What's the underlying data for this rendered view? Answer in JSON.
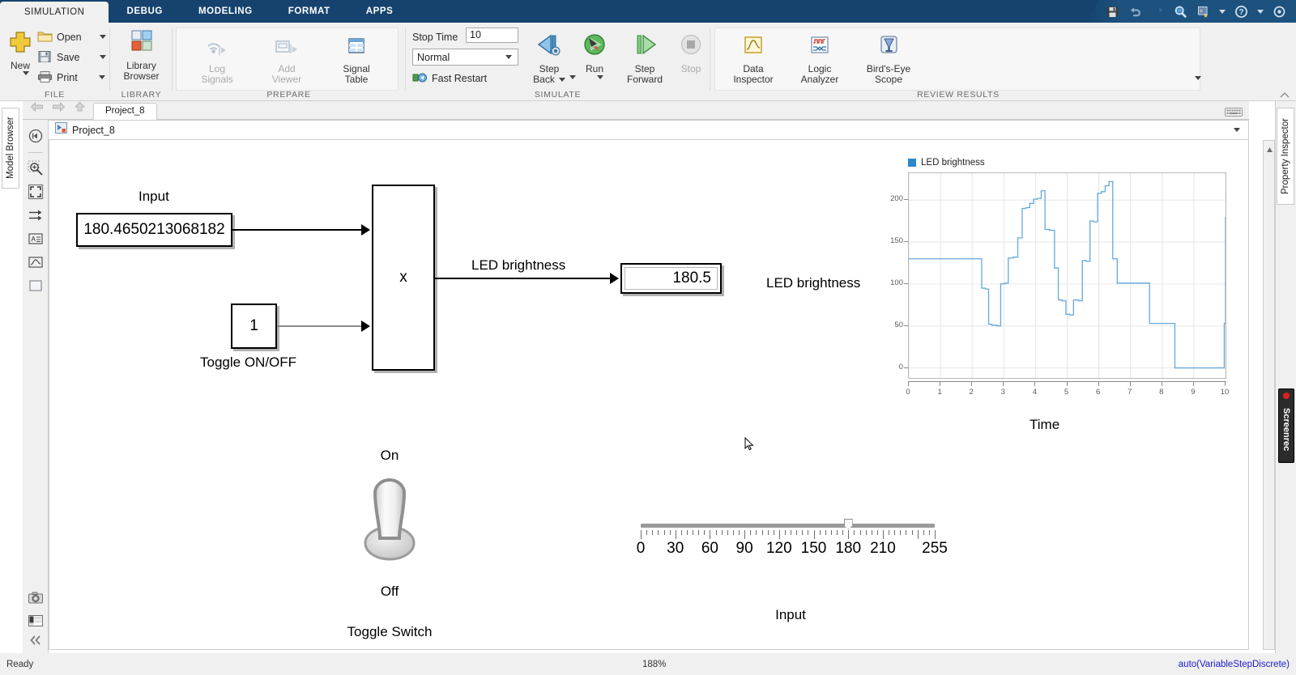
{
  "window": {
    "ribbon_tabs": [
      {
        "label": "SIMULATION",
        "active": true
      },
      {
        "label": "DEBUG",
        "active": false
      },
      {
        "label": "MODELING",
        "active": false
      },
      {
        "label": "FORMAT",
        "active": false
      },
      {
        "label": "APPS",
        "active": false
      }
    ],
    "quick_access": [
      "save-icon",
      "undo-icon",
      "redo-icon",
      "search-icon",
      "favorites-icon",
      "help-icon",
      "settings-icon"
    ]
  },
  "ribbon": {
    "file_group": {
      "label": "FILE",
      "new_label": "New",
      "items": [
        {
          "label": "Open",
          "icon": "folder-icon"
        },
        {
          "label": "Save",
          "icon": "floppy-icon"
        },
        {
          "label": "Print",
          "icon": "printer-icon"
        }
      ]
    },
    "library_group": {
      "label": "LIBRARY",
      "button": "Library\nBrowser",
      "button_line1": "Library",
      "button_line2": "Browser"
    },
    "prepare_group": {
      "label": "PREPARE",
      "items": [
        {
          "line1": "Log",
          "line2": "Signals",
          "disabled": true,
          "icon": "log-signals-icon"
        },
        {
          "line1": "Add",
          "line2": "Viewer",
          "disabled": true,
          "icon": "add-viewer-icon"
        },
        {
          "line1": "Signal",
          "line2": "Table",
          "disabled": false,
          "icon": "signal-table-icon"
        }
      ]
    },
    "simulate_group": {
      "label": "SIMULATE",
      "stop_time_label": "Stop Time",
      "stop_time_value": "10",
      "mode_value": "Normal",
      "fast_restart_label": "Fast Restart",
      "buttons": [
        {
          "line1": "Step",
          "line2": "Back",
          "has_caret": true,
          "disabled": false,
          "icon": "step-back-icon"
        },
        {
          "line1": "Run",
          "line2": "",
          "has_caret": true,
          "disabled": false,
          "icon": "run-icon"
        },
        {
          "line1": "Step",
          "line2": "Forward",
          "has_caret": false,
          "disabled": false,
          "icon": "step-forward-icon"
        },
        {
          "line1": "Stop",
          "line2": "",
          "has_caret": false,
          "disabled": true,
          "icon": "stop-icon"
        }
      ]
    },
    "review_group": {
      "label": "REVIEW RESULTS",
      "items": [
        {
          "line1": "Data",
          "line2": "Inspector",
          "icon": "data-inspector-icon"
        },
        {
          "line1": "Logic",
          "line2": "Analyzer",
          "icon": "logic-analyzer-icon"
        },
        {
          "line1": "Bird's-Eye",
          "line2": "Scope",
          "icon": "birds-eye-scope-icon"
        }
      ]
    }
  },
  "docks": {
    "model_browser_label": "Model Browser",
    "property_inspector_label": "Property Inspector",
    "screenrec_label": "Screenrec"
  },
  "model": {
    "tab_label": "Project_8",
    "breadcrumb": "Project_8"
  },
  "diagram": {
    "input_label": "Input",
    "input_value": "180.4650213068182",
    "constant_value": "1",
    "toggle_block_label": "Toggle ON/OFF",
    "product_symbol": "x",
    "signal_label": "LED brightness",
    "display_value": "180.5"
  },
  "toggle_switch": {
    "on_label": "On",
    "off_label": "Off",
    "caption": "Toggle Switch",
    "state": "On"
  },
  "slider": {
    "caption": "Input",
    "value": 180,
    "min": 0,
    "max": 255,
    "tick_labels": [
      "0",
      "30",
      "60",
      "90",
      "120",
      "150",
      "180",
      "210",
      "255"
    ]
  },
  "chart_data": {
    "type": "line",
    "title": "",
    "legend": [
      "LED brightness"
    ],
    "legend_position": "top-left",
    "series_color": "#64a8dd",
    "xlabel": "Time",
    "ylabel": "LED brightness",
    "xlim": [
      0,
      10
    ],
    "ylim": [
      -12,
      232
    ],
    "xticks": [
      0,
      1,
      2,
      3,
      4,
      5,
      6,
      7,
      8,
      9,
      10
    ],
    "yticks": [
      0,
      50,
      100,
      150,
      200
    ],
    "grid": true,
    "series": [
      {
        "name": "LED brightness",
        "x": [
          0.0,
          2.18,
          2.3,
          2.42,
          2.52,
          2.62,
          2.78,
          2.9,
          3.02,
          3.14,
          3.3,
          3.44,
          3.58,
          3.7,
          3.82,
          3.94,
          4.06,
          4.18,
          4.3,
          4.44,
          4.6,
          4.72,
          4.84,
          4.96,
          5.08,
          5.2,
          5.36,
          5.48,
          5.6,
          5.72,
          5.84,
          5.96,
          6.08,
          6.2,
          6.32,
          6.44,
          6.58,
          7.6,
          8.4,
          9.96,
          10.0
        ],
        "y": [
          130,
          130,
          95,
          94,
          52,
          51,
          50,
          100,
          101,
          131,
          132,
          155,
          190,
          191,
          196,
          201,
          202,
          211,
          165,
          164,
          119,
          81,
          80,
          64,
          63,
          81,
          80,
          128,
          127,
          175,
          174,
          208,
          210,
          217,
          222,
          130,
          101,
          53,
          0,
          53,
          180
        ],
        "step": true
      }
    ]
  },
  "status": {
    "ready": "Ready",
    "zoom": "188%",
    "solver": "auto(VariableStepDiscrete)"
  }
}
